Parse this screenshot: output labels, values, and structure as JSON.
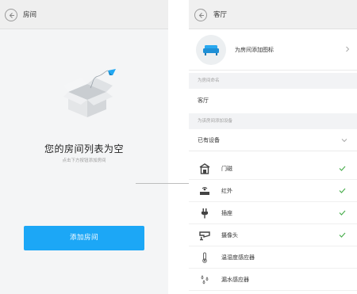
{
  "left_screen": {
    "header": {
      "title": "房间"
    },
    "empty_state": {
      "title": "您的房间列表为空",
      "hint": "点击下方按钮添加房间"
    },
    "add_button_label": "添加房间"
  },
  "right_screen": {
    "header": {
      "title": "客厅"
    },
    "icon_row": {
      "label": "为房间添加图标"
    },
    "name_section": {
      "header": "为房间命名",
      "value": "客厅"
    },
    "devices_section": {
      "header": "为该房间添加设备",
      "existing_label": "已有设备",
      "items": [
        {
          "name": "门磁",
          "icon": "door-sensor-icon",
          "checked": true
        },
        {
          "name": "红外",
          "icon": "infrared-icon",
          "checked": true
        },
        {
          "name": "插座",
          "icon": "socket-icon",
          "checked": true
        },
        {
          "name": "摄像头",
          "icon": "camera-icon",
          "checked": true
        },
        {
          "name": "温湿度感应器",
          "icon": "thermometer-icon",
          "checked": false
        },
        {
          "name": "漏水感应器",
          "icon": "water-leak-icon",
          "checked": false
        }
      ]
    }
  },
  "colors": {
    "accent": "#1ca7f6",
    "check": "#4caf50",
    "bg": "#f4f5f6"
  }
}
